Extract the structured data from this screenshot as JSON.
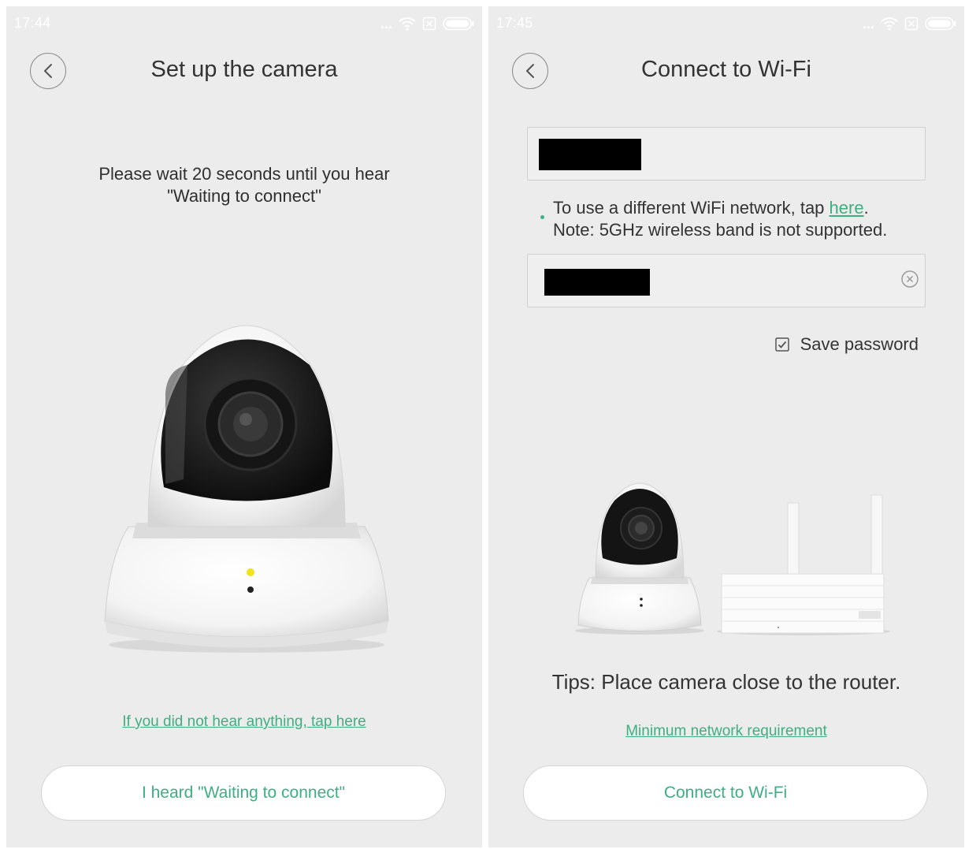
{
  "left": {
    "status": {
      "time": "17:44",
      "dots": "..."
    },
    "title": "Set up the camera",
    "instruction": "Please wait 20 seconds until you hear \"Waiting to connect\"",
    "help_link": "If you did not hear anything, tap here",
    "primary_button": "I heard \"Waiting to connect\""
  },
  "right": {
    "status": {
      "time": "17:45",
      "dots": "..."
    },
    "title": "Connect to Wi-Fi",
    "wifi_note": {
      "line1_prefix": "To use a different WiFi network, tap ",
      "line1_link": "here",
      "line1_suffix": ".",
      "line2": "Note: 5GHz wireless band is not supported."
    },
    "save_password": {
      "label": "Save password",
      "checked": true
    },
    "tips": "Tips: Place camera close to the router.",
    "requirement_link": "Minimum network requirement",
    "primary_button": "Connect to Wi-Fi"
  },
  "colors": {
    "accent": "#3fae83",
    "screen_background": "#ececec",
    "indicator_led": "#f2e21c"
  },
  "icons": [
    "back-icon",
    "wifi-icon",
    "sim-off-icon",
    "battery-icon",
    "clear-icon",
    "checkbox-icon"
  ]
}
